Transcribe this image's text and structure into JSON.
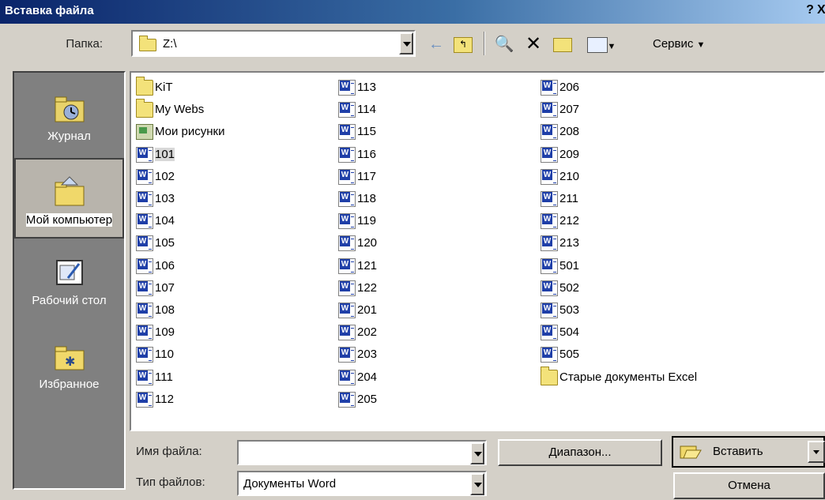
{
  "dialog": {
    "title": "Вставка файла",
    "help": "?",
    "close": "X"
  },
  "lookin": {
    "label": "Папка:",
    "value": "Z:\\"
  },
  "toolbar": {
    "service_label": "Сервис"
  },
  "places": [
    {
      "label": "Журнал",
      "icon": "history-icon"
    },
    {
      "label": "Мой компьютер",
      "icon": "my-computer-icon",
      "selected": true
    },
    {
      "label": "Рабочий стол",
      "icon": "desktop-icon"
    },
    {
      "label": "Избранное",
      "icon": "favorites-icon"
    }
  ],
  "files": {
    "col1": [
      {
        "name": "KiT",
        "type": "folder"
      },
      {
        "name": "My Webs",
        "type": "folder"
      },
      {
        "name": "Мои рисунки",
        "type": "pictures"
      },
      {
        "name": "101",
        "type": "word",
        "selected": true
      },
      {
        "name": "102",
        "type": "word"
      },
      {
        "name": "103",
        "type": "word"
      },
      {
        "name": "104",
        "type": "word"
      },
      {
        "name": "105",
        "type": "word"
      },
      {
        "name": "106",
        "type": "word"
      },
      {
        "name": "107",
        "type": "word"
      },
      {
        "name": "108",
        "type": "word"
      },
      {
        "name": "109",
        "type": "word"
      },
      {
        "name": "110",
        "type": "word"
      },
      {
        "name": "111",
        "type": "word"
      },
      {
        "name": "112",
        "type": "word"
      }
    ],
    "col2": [
      {
        "name": "113",
        "type": "word"
      },
      {
        "name": "114",
        "type": "word"
      },
      {
        "name": "115",
        "type": "word"
      },
      {
        "name": "116",
        "type": "word"
      },
      {
        "name": "117",
        "type": "word"
      },
      {
        "name": "118",
        "type": "word"
      },
      {
        "name": "119",
        "type": "word"
      },
      {
        "name": "120",
        "type": "word"
      },
      {
        "name": "121",
        "type": "word"
      },
      {
        "name": "122",
        "type": "word"
      },
      {
        "name": "201",
        "type": "word"
      },
      {
        "name": "202",
        "type": "word"
      },
      {
        "name": "203",
        "type": "word"
      },
      {
        "name": "204",
        "type": "word"
      },
      {
        "name": "205",
        "type": "word"
      }
    ],
    "col3": [
      {
        "name": "206",
        "type": "word"
      },
      {
        "name": "207",
        "type": "word"
      },
      {
        "name": "208",
        "type": "word"
      },
      {
        "name": "209",
        "type": "word"
      },
      {
        "name": "210",
        "type": "word"
      },
      {
        "name": "211",
        "type": "word"
      },
      {
        "name": "212",
        "type": "word"
      },
      {
        "name": "213",
        "type": "word"
      },
      {
        "name": "501",
        "type": "word"
      },
      {
        "name": "502",
        "type": "word"
      },
      {
        "name": "503",
        "type": "word"
      },
      {
        "name": "504",
        "type": "word"
      },
      {
        "name": "505",
        "type": "word"
      },
      {
        "name": "Старые документы Excel",
        "type": "folder"
      }
    ]
  },
  "bottom": {
    "filename_label": "Имя файла:",
    "filename_value": "",
    "filetype_label": "Тип файлов:",
    "filetype_value": "Документы Word",
    "range_button": "Диапазон...",
    "insert_button": "Вставить",
    "cancel_button": "Отмена"
  }
}
